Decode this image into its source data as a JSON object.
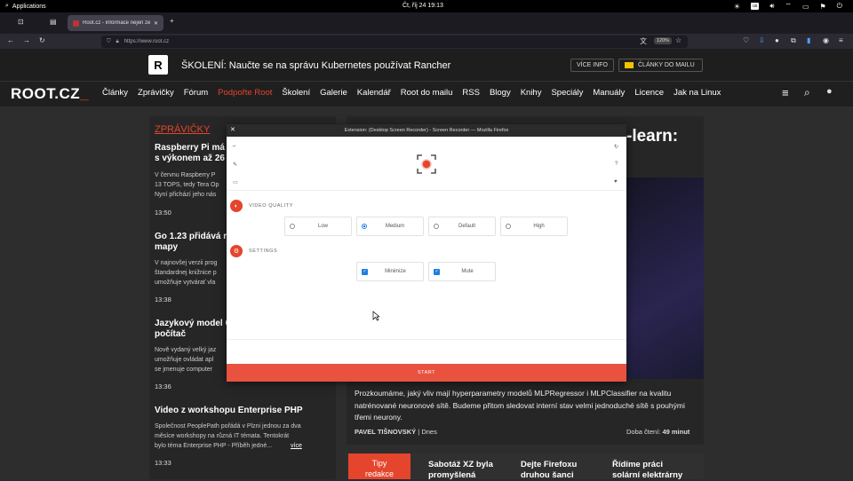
{
  "system_bar": {
    "apps_label": "Applications",
    "clock": "Čt, říj 24   19:13",
    "kb_layout": "us"
  },
  "browser": {
    "tab_title": "Root.cz - informace nejen ze",
    "url": "https://www.root.cz",
    "zoom": "120%"
  },
  "promo": {
    "logo_letter": "R",
    "text": "ŠKOLENÍ: Naučte se na správu Kubernetes používat Rancher",
    "more_btn": "VÍCE INFO",
    "newsletter_btn": "ČLÁNKY DO MAILU"
  },
  "site": {
    "logo": "ROOT.CZ",
    "logo_accent": "_",
    "menu": [
      "Články",
      "Zprávičky",
      "Fórum",
      "Podpořte Root",
      "Školení",
      "Galerie",
      "Kalendář",
      "Root do mailu",
      "RSS",
      "Blogy",
      "Knihy",
      "Speciály",
      "Manuály",
      "Licence",
      "Jak na Linux"
    ]
  },
  "news": {
    "heading": "ZPRÁVIČKY",
    "items": [
      {
        "title": "Raspberry Pi má\ns výkonem až 26",
        "text": "V červnu Raspberry P\n13 TOPS, tedy Tera Op\nNyní přichází jeho nás",
        "time": "13:50"
      },
      {
        "title": "Go 1.23 přidává r\nmapy",
        "text": "V najnovšej verzii prog\nštandardnej knižnice p\numožňuje vytvárať vla",
        "time": "13:38"
      },
      {
        "title": "Jazykový model C\npočítač",
        "text": "Nově vydaný velký jaz\numožňuje ovládat apl\nse jmenuje computer",
        "time": "13:36"
      },
      {
        "title": "Video z workshopu Enterprise PHP",
        "text": "Společnost PeoplePath pořádá v Plzni jednou za dva\nměsíce workshopy na různá IT témata. Tentokrát\nbylo téma Enterprise PHP - Příběh jedné...",
        "more": "více",
        "time": "13:33"
      }
    ]
  },
  "article": {
    "title_fragment": "-learn:",
    "description": "Prozkoumáme, jaký vliv mají hyperparametry modelů MLPRegressor i MLPClassifier na kvalitu natrénované neuronové sítě. Budeme přitom sledovat interní stav velmi jednoduché sítě s pouhými třemi neurony.",
    "author": "PAVEL TIŠNOVSKÝ",
    "date": "Dnes",
    "read_label": "Doba čtení:",
    "read_time": "49 minut"
  },
  "strip": {
    "tipy": "Tipy\nredakce",
    "items": [
      "Sabotáž XZ byla\npromyšlená",
      "Dejte Firefoxu\ndruhou šanci",
      "Řídíme práci\nsolární elektrárny"
    ]
  },
  "popup": {
    "window_title": "Extension: (Desktop Screen Recorder) - Screen Recorder — Mozilla Firefox",
    "video_quality_label": "VIDEO QUALITY",
    "quality_options": [
      "Low",
      "Medium",
      "Default",
      "High"
    ],
    "selected_quality": "Medium",
    "settings_label": "SETTINGS",
    "settings_options": [
      {
        "label": "Minimize",
        "checked": true
      },
      {
        "label": "Mute",
        "checked": true
      }
    ],
    "start_label": "START"
  }
}
